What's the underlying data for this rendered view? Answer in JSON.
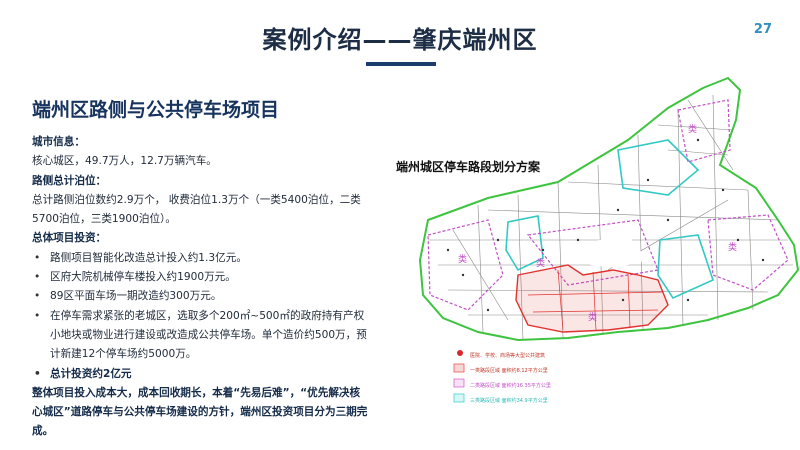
{
  "header": {
    "title": "案例介绍——肇庆端州区",
    "page_number": "27"
  },
  "section_title": "端州区路侧与公共停车场项目",
  "city_info": {
    "label": "城市信息：",
    "text": "核心城区，49.7万人，12.7万辆汽车。"
  },
  "roadside": {
    "label": "路侧总计泊位：",
    "text": "总计路侧泊位数约2.9万个， 收费泊位1.3万个（一类5400泊位，二类5700泊位，三类1900泊位）。"
  },
  "investment": {
    "label": "总体项目投资：",
    "items": [
      "路侧项目智能化改造总计投入约1.3亿元。",
      "区府大院机械停车楼投入约1900万元。",
      "89区平面车场一期改造约300万元。",
      "在停车需求紧张的老城区，选取多个200㎡~500㎡的政府持有产权小地块或物业进行建设或改造成公共停车场。单个造价约500万，预计新建12个停车场约5000万。"
    ],
    "total": "总计投资约2亿元"
  },
  "conclusion": "整体项目投入成本大，成本回收期长，本着“先易后难”，“优先解决核心城区”道路停车与公共停车场建设的方针，端州区投资项目分为三期完成。",
  "map": {
    "title": "端州城区停车路段划分方案",
    "legend": [
      {
        "label": "医院、学校、商场等大型公共建筑",
        "color": "#d9262a",
        "kind": "dot"
      },
      {
        "label": "一类路段区域    面积约8.12平方公里",
        "color": "#e45a5a",
        "kind": "box"
      },
      {
        "label": "二类路段区域    面积约16.35平方公里",
        "color": "#d86ad0",
        "kind": "box"
      },
      {
        "label": "三类路段区域    面积约34.9平方公里",
        "color": "#3fd4d0",
        "kind": "box"
      }
    ],
    "colors": {
      "outer_boundary": "#3ec43e",
      "class1": "#e0322e",
      "class2": "#c34ec9",
      "class3": "#32c9c5",
      "roads": "#8a8a8a"
    }
  }
}
